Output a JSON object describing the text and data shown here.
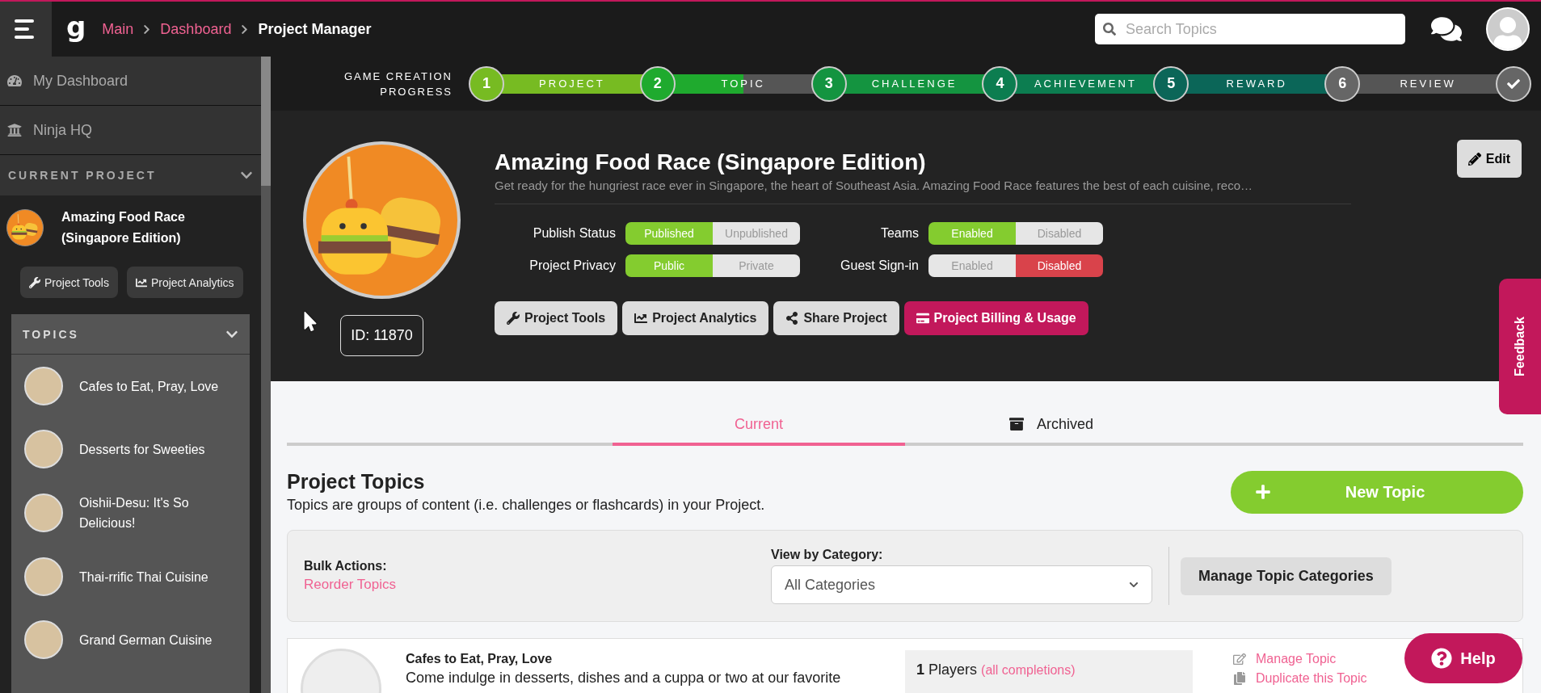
{
  "topbar": {
    "logo": "g",
    "breadcrumbs": [
      {
        "label": "Main",
        "kind": "link"
      },
      {
        "label": "Dashboard",
        "kind": "link"
      },
      {
        "label": "Project Manager",
        "kind": "current"
      }
    ],
    "search": {
      "placeholder": "Search Topics"
    }
  },
  "sidebar": {
    "nav": [
      "My Dashboard",
      "Ninja HQ"
    ],
    "current_project": {
      "heading": "CURRENT PROJECT",
      "name": "Amazing Food Race (Singapore Edition)",
      "buttons": [
        "Project Tools",
        "Project Analytics"
      ]
    },
    "topics": {
      "heading": "TOPICS",
      "items": [
        "Cafes to Eat, Pray, Love",
        "Desserts for Sweeties",
        "Oishii-Desu: It's So Delicious!",
        "Thai-rrific Thai Cuisine",
        "Grand German Cuisine"
      ]
    }
  },
  "progress": {
    "label": "GAME CREATION PROGRESS",
    "steps": [
      {
        "number": "1",
        "label": "PROJECT",
        "color": "#77bb22",
        "level": 1
      },
      {
        "number": "2",
        "label": "TOPIC",
        "color": "#1faa2e",
        "level": 0.5
      },
      {
        "number": "3",
        "label": "CHALLENGE",
        "color": "#149440",
        "level": 1
      },
      {
        "number": "4",
        "label": "ACHIEVEMENT",
        "color": "#0c7d50",
        "level": 1
      },
      {
        "number": "5",
        "label": "REWARD",
        "color": "#0b6658",
        "level": 1
      },
      {
        "number": "6",
        "label": "REVIEW",
        "color": "#666666"
      }
    ]
  },
  "project": {
    "title": "Amazing Food Race (Singapore Edition)",
    "description": "Get ready for the hungriest race ever in Singapore, the heart of Southeast Asia. Amazing Food Race features the best of each cuisine, reco…",
    "id": "ID: 11870",
    "edit": "Edit",
    "toggles": [
      {
        "label": "Publish Status",
        "color": "#84cc2f",
        "options": [
          {
            "label": "Published",
            "selected": true
          },
          {
            "label": "Unpublished",
            "selected": false
          }
        ]
      },
      {
        "label": "Teams",
        "color": "#84cc2f",
        "options": [
          {
            "label": "Enabled",
            "selected": true
          },
          {
            "label": "Disabled",
            "selected": false
          }
        ]
      },
      {
        "label": "Project Privacy",
        "color": "#84cc2f",
        "options": [
          {
            "label": "Public",
            "selected": true
          },
          {
            "label": "Private",
            "selected": false
          }
        ]
      },
      {
        "label": "Guest Sign-in",
        "color": "#d9434b",
        "options": [
          {
            "label": "Enabled",
            "selected": false
          },
          {
            "label": "Disabled",
            "selected": true
          }
        ]
      }
    ],
    "actions": [
      {
        "label": "Project Tools",
        "kind": "tools"
      },
      {
        "label": "Project Analytics",
        "kind": "analytics"
      },
      {
        "label": "Share Project",
        "kind": "share"
      },
      {
        "label": "Project Billing & Usage",
        "kind": "billing"
      }
    ]
  },
  "tabs": [
    {
      "label": "Current",
      "selected": true
    },
    {
      "label": "Archived",
      "selected": false
    }
  ],
  "topics_section": {
    "title": "Project Topics",
    "subtitle": "Topics are groups of content (i.e. challenges or flashcards) in your Project.",
    "new_button": "New Topic",
    "bulk_label": "Bulk Actions:",
    "bulk_link": "Reorder Topics",
    "category_label": "View by Category:",
    "category_value": "All Categories",
    "manage_button": "Manage Topic Categories",
    "card": {
      "title": "Cafes to Eat, Pray, Love",
      "description": "Come indulge in desserts, dishes and a cuppa or two at our favorite",
      "players_count": "1",
      "players_label": "Players",
      "completions": "(all completions)",
      "links": [
        "Manage Topic",
        "Duplicate this Topic"
      ]
    }
  },
  "feedback": "Feedback",
  "help": "Help"
}
